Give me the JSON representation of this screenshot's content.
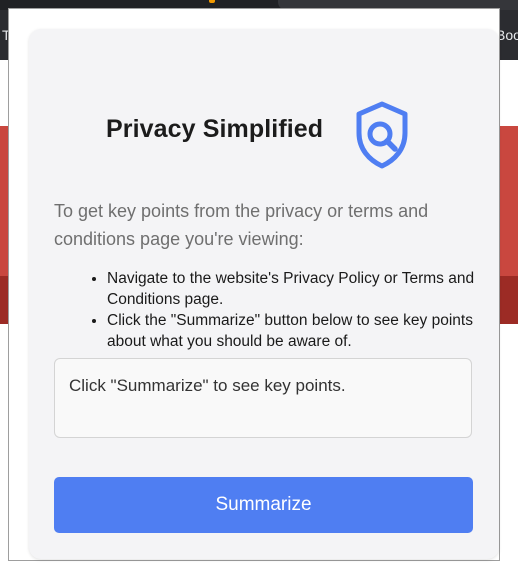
{
  "background": {
    "bookmark_left_fragment": "T",
    "bookmark_right_fragment": "Boo"
  },
  "popup": {
    "title": "Privacy Simplified",
    "logo_icon": "shield-search-icon",
    "intro": "To get key points from the privacy or terms and conditions page you're viewing:",
    "steps": [
      "Navigate to the website's Privacy Policy or Terms and Conditions page.",
      "Click the \"Summarize\" button below to see key points about what you should be aware of."
    ],
    "output_text": "Click \"Summarize\" to see key points.",
    "summarize_label": "Summarize",
    "colors": {
      "accent": "#4f7ef2",
      "title": "#1c1c1c",
      "card_bg": "#f4f4f6"
    }
  }
}
